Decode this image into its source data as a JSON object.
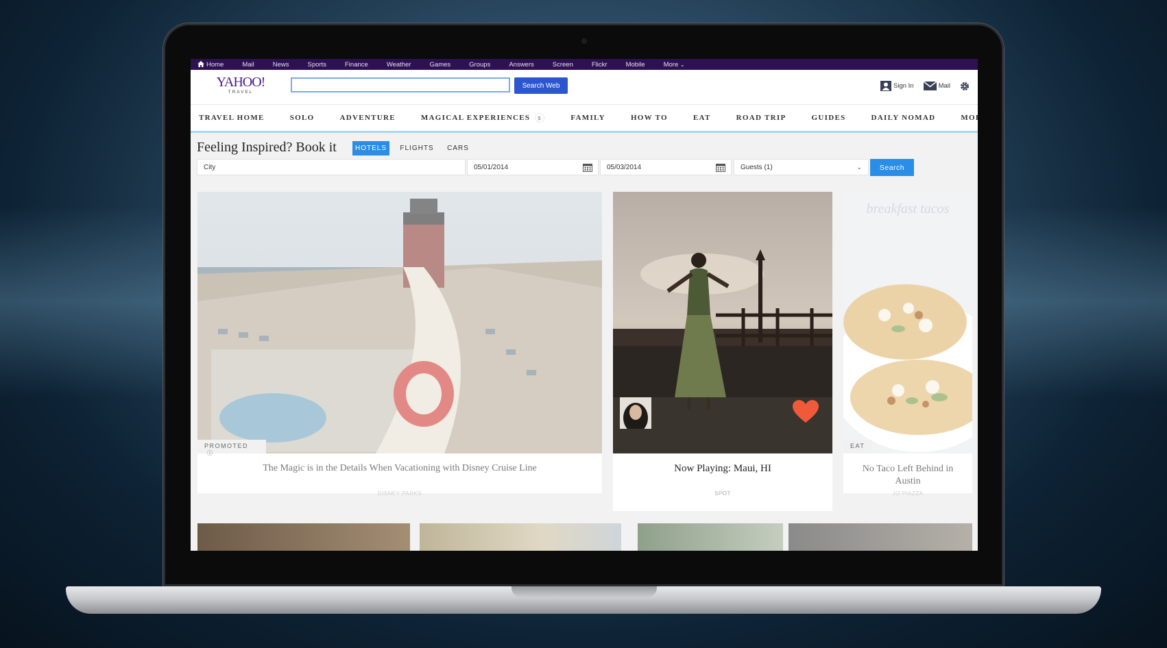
{
  "topnav": {
    "items": [
      "Home",
      "Mail",
      "News",
      "Sports",
      "Finance",
      "Weather",
      "Games",
      "Groups",
      "Answers",
      "Screen",
      "Flickr",
      "Mobile",
      "More"
    ]
  },
  "header": {
    "logo_main": "YAHOO!",
    "logo_sub": "TRAVEL",
    "search_placeholder": "",
    "search_button": "Search Web",
    "sign_in": "Sign In",
    "mail": "Mail"
  },
  "catnav": {
    "items": [
      "TRAVEL HOME",
      "SOLO",
      "ADVENTURE",
      "MAGICAL EXPERIENCES",
      "FAMILY",
      "HOW TO",
      "EAT",
      "ROAD TRIP",
      "GUIDES",
      "DAILY NOMAD",
      "MORE"
    ]
  },
  "booking": {
    "title": "Feeling Inspired? Book it",
    "tabs": [
      "HOTELS",
      "FLIGHTS",
      "CARS"
    ],
    "active_tab": "HOTELS",
    "city_placeholder": "City",
    "checkin": "05/01/2014",
    "checkout": "05/03/2014",
    "guests": "Guests (1)",
    "search_button": "Search"
  },
  "cards": [
    {
      "badge": "PROMOTED",
      "title": "The Magic is in the Details When Vacationing with Disney Cruise Line",
      "source": "DISNEY PARKS"
    },
    {
      "badge": "",
      "title": "Now Playing: Maui, HI",
      "source": "SPOT"
    },
    {
      "badge": "EAT",
      "title": "No Taco Left Behind in Austin",
      "source": "JO PIAZZA",
      "image_text": "breakfast tacos"
    }
  ],
  "colors": {
    "topbar": "#2d1152",
    "brand": "#4a1a80",
    "accent": "#2a8ee8",
    "search_btn": "#2c56d0",
    "heart": "#ef5a3a"
  }
}
